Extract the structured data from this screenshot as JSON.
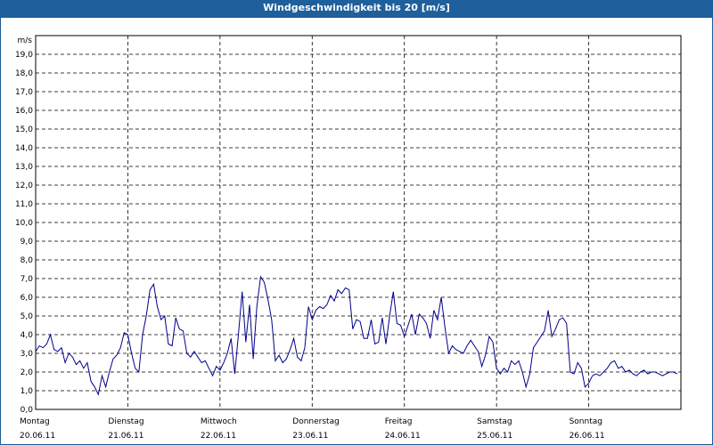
{
  "window": {
    "title": "Windgeschwindigkeit bis 20 [m/s]"
  },
  "colors": {
    "titlebar": "#1f5f9b",
    "line": "#00008b",
    "grid": "#000000"
  },
  "chart_data": {
    "type": "line",
    "title": "Windgeschwindigkeit bis 20 [m/s]",
    "ylabel": "m/s",
    "ylim": [
      0,
      20
    ],
    "yticks": [
      "0,0",
      "1,0",
      "2,0",
      "3,0",
      "4,0",
      "5,0",
      "6,0",
      "7,0",
      "8,0",
      "9,0",
      "10,0",
      "11,0",
      "12,0",
      "13,0",
      "14,0",
      "15,0",
      "16,0",
      "17,0",
      "18,0",
      "19,0"
    ],
    "xlim": [
      0,
      7
    ],
    "days": [
      {
        "name": "Montag",
        "date": "20.06.11"
      },
      {
        "name": "Dienstag",
        "date": "21.06.11"
      },
      {
        "name": "Mittwoch",
        "date": "22.06.11"
      },
      {
        "name": "Donnerstag",
        "date": "23.06.11"
      },
      {
        "name": "Freitag",
        "date": "24.06.11"
      },
      {
        "name": "Samstag",
        "date": "25.06.11"
      },
      {
        "name": "Sonntag",
        "date": "26.06.11"
      }
    ],
    "grid": true,
    "series": [
      {
        "x": [
          0.0,
          0.04,
          0.08,
          0.12,
          0.16,
          0.2,
          0.24,
          0.28,
          0.32,
          0.36,
          0.4,
          0.44,
          0.48,
          0.52,
          0.56,
          0.6,
          0.64,
          0.68,
          0.72,
          0.76,
          0.8,
          0.84,
          0.88,
          0.92,
          0.96,
          1.0,
          1.04,
          1.08,
          1.12,
          1.16,
          1.2,
          1.24,
          1.28,
          1.32,
          1.36,
          1.4,
          1.44,
          1.48,
          1.52,
          1.56,
          1.6,
          1.64,
          1.68,
          1.72,
          1.76,
          1.8,
          1.84,
          1.88,
          1.92,
          1.96,
          2.0,
          2.04,
          2.08,
          2.12,
          2.16,
          2.2,
          2.24,
          2.28,
          2.32,
          2.36,
          2.4,
          2.44,
          2.48,
          2.52,
          2.56,
          2.6,
          2.64,
          2.68,
          2.72,
          2.76,
          2.8,
          2.84,
          2.88,
          2.92,
          2.96,
          3.0,
          3.04,
          3.08,
          3.12,
          3.16,
          3.2,
          3.24,
          3.28,
          3.32,
          3.36,
          3.4,
          3.44,
          3.48,
          3.52,
          3.56,
          3.6,
          3.64,
          3.68,
          3.72,
          3.76,
          3.8,
          3.84,
          3.88,
          3.92,
          3.96,
          4.0,
          4.04,
          4.08,
          4.12,
          4.16,
          4.2,
          4.24,
          4.28,
          4.32,
          4.36,
          4.4,
          4.44,
          4.48,
          4.52,
          4.56,
          4.6,
          4.64,
          4.68,
          4.72,
          4.76,
          4.8,
          4.84,
          4.88,
          4.92,
          4.96,
          5.0,
          5.04,
          5.08,
          5.12,
          5.16,
          5.2,
          5.24,
          5.28,
          5.32,
          5.36,
          5.4,
          5.44,
          5.48,
          5.52,
          5.56,
          5.6,
          5.64,
          5.68,
          5.72,
          5.76,
          5.8,
          5.84,
          5.88,
          5.92,
          5.96,
          6.0,
          6.04,
          6.08,
          6.12,
          6.16,
          6.2,
          6.24,
          6.28,
          6.32,
          6.36,
          6.4,
          6.44,
          6.48,
          6.52,
          6.56,
          6.6,
          6.64,
          6.68,
          6.72,
          6.76,
          6.8,
          6.84,
          6.88,
          6.92,
          6.96
        ],
        "y": [
          3.1,
          3.4,
          3.3,
          3.5,
          4.0,
          3.2,
          3.1,
          3.3,
          2.5,
          3.0,
          2.8,
          2.4,
          2.6,
          2.2,
          2.5,
          1.5,
          1.2,
          0.8,
          1.8,
          1.2,
          2.0,
          2.7,
          2.9,
          3.3,
          4.1,
          4.0,
          3.0,
          2.2,
          2.0,
          4.0,
          5.0,
          6.4,
          6.7,
          5.5,
          4.8,
          5.0,
          3.5,
          3.4,
          4.9,
          4.3,
          4.2,
          3.0,
          2.8,
          3.1,
          2.8,
          2.5,
          2.6,
          2.2,
          1.8,
          2.3,
          2.1,
          2.5,
          3.0,
          3.8,
          1.9,
          4.0,
          6.3,
          3.6,
          5.6,
          2.7,
          5.5,
          7.1,
          6.8,
          5.9,
          4.8,
          2.6,
          2.9,
          2.5,
          2.7,
          3.2,
          3.8,
          2.8,
          2.6,
          3.3,
          5.5,
          4.8,
          5.3,
          5.5,
          5.4,
          5.6,
          6.1,
          5.8,
          6.4,
          6.2,
          6.5,
          6.4,
          4.3,
          4.8,
          4.7,
          3.8,
          3.8,
          4.8,
          3.5,
          3.6,
          4.9,
          3.5,
          5.0,
          6.3,
          4.6,
          4.5,
          3.9,
          4.5,
          5.1,
          4.0,
          5.1,
          4.9,
          4.6,
          3.8,
          5.3,
          4.8,
          6.0,
          4.4,
          3.0,
          3.4,
          3.2,
          3.1,
          3.0,
          3.4,
          3.7,
          3.4,
          3.1,
          2.3,
          2.9,
          3.9,
          3.6,
          2.2,
          1.9,
          2.2,
          2.0,
          2.6,
          2.4,
          2.6,
          2.0,
          1.2,
          1.9,
          3.3,
          3.6,
          3.9,
          4.2,
          5.3,
          3.9,
          4.3,
          4.8,
          4.9,
          4.6,
          2.0,
          1.9,
          2.5,
          2.2,
          1.2,
          1.4,
          1.8,
          1.9,
          1.8,
          2.0,
          2.2,
          2.5,
          2.6,
          2.2,
          2.3,
          2.0,
          2.1,
          1.9,
          1.8,
          2.0,
          2.1,
          1.9,
          2.0,
          2.0,
          1.9,
          1.8,
          1.9,
          2.0,
          2.0,
          1.9
        ]
      }
    ]
  }
}
